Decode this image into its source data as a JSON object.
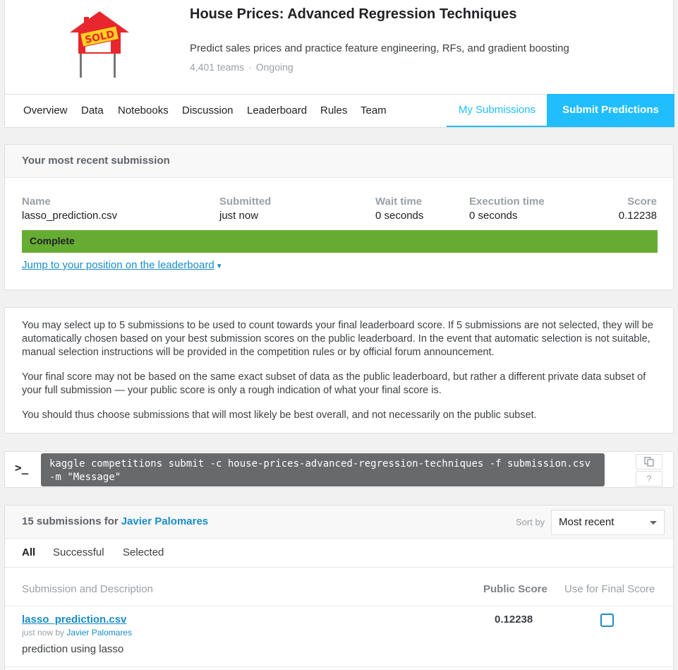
{
  "competition": {
    "title": "House Prices: Advanced Regression Techniques",
    "description": "Predict sales prices and practice feature engineering, RFs, and gradient boosting",
    "teams": "4,401 teams",
    "separator": "·",
    "status": "Ongoing",
    "logo_text": "SOLD"
  },
  "nav": {
    "items": [
      "Overview",
      "Data",
      "Notebooks",
      "Discussion",
      "Leaderboard",
      "Rules",
      "Team"
    ],
    "my_submissions": "My Submissions",
    "submit_predictions": "Submit Predictions"
  },
  "recent": {
    "heading": "Your most recent submission",
    "labels": {
      "name": "Name",
      "submitted": "Submitted",
      "wait": "Wait time",
      "execution": "Execution time",
      "score": "Score"
    },
    "values": {
      "name": "lasso_prediction.csv",
      "submitted": "just now",
      "wait": "0 seconds",
      "execution": "0 seconds",
      "score": "0.12238"
    },
    "status": "Complete",
    "jump_link": "Jump to your position on the leaderboard"
  },
  "info": {
    "p1": "You may select up to 5 submissions to be used to count towards your final leaderboard score. If 5 submissions are not selected, they will be automatically chosen based on your best submission scores on the public leaderboard. In the event that automatic selection is not suitable, manual selection instructions will be provided in the competition rules or by official forum announcement.",
    "p2": "Your final score may not be based on the same exact subset of data as the public leaderboard, but rather a different private data subset of your full submission — your public score is only a rough indication of what your final score is.",
    "p3": "You should thus choose submissions that will most likely be best overall, and not necessarily on the public subset."
  },
  "command": {
    "prompt": ">_",
    "text": "kaggle competitions submit -c house-prices-advanced-regression-techniques -f submission.csv\n-m \"Message\"",
    "help": "?"
  },
  "submissions": {
    "count_label": "15 submissions for",
    "user": "Javier Palomares",
    "sort_label": "Sort by",
    "sort_value": "Most recent",
    "filters": [
      "All",
      "Successful",
      "Selected"
    ],
    "headers": {
      "desc": "Submission and Description",
      "public": "Public Score",
      "final": "Use for Final Score"
    },
    "rows": [
      {
        "file": "lasso_prediction.csv",
        "time": "just now",
        "by": "by",
        "author": "Javier Palomares",
        "description": "prediction using lasso",
        "score": "0.12238"
      }
    ]
  },
  "colors": {
    "accent": "#20beff",
    "link": "#1a8cc7",
    "complete": "#66ac33"
  }
}
